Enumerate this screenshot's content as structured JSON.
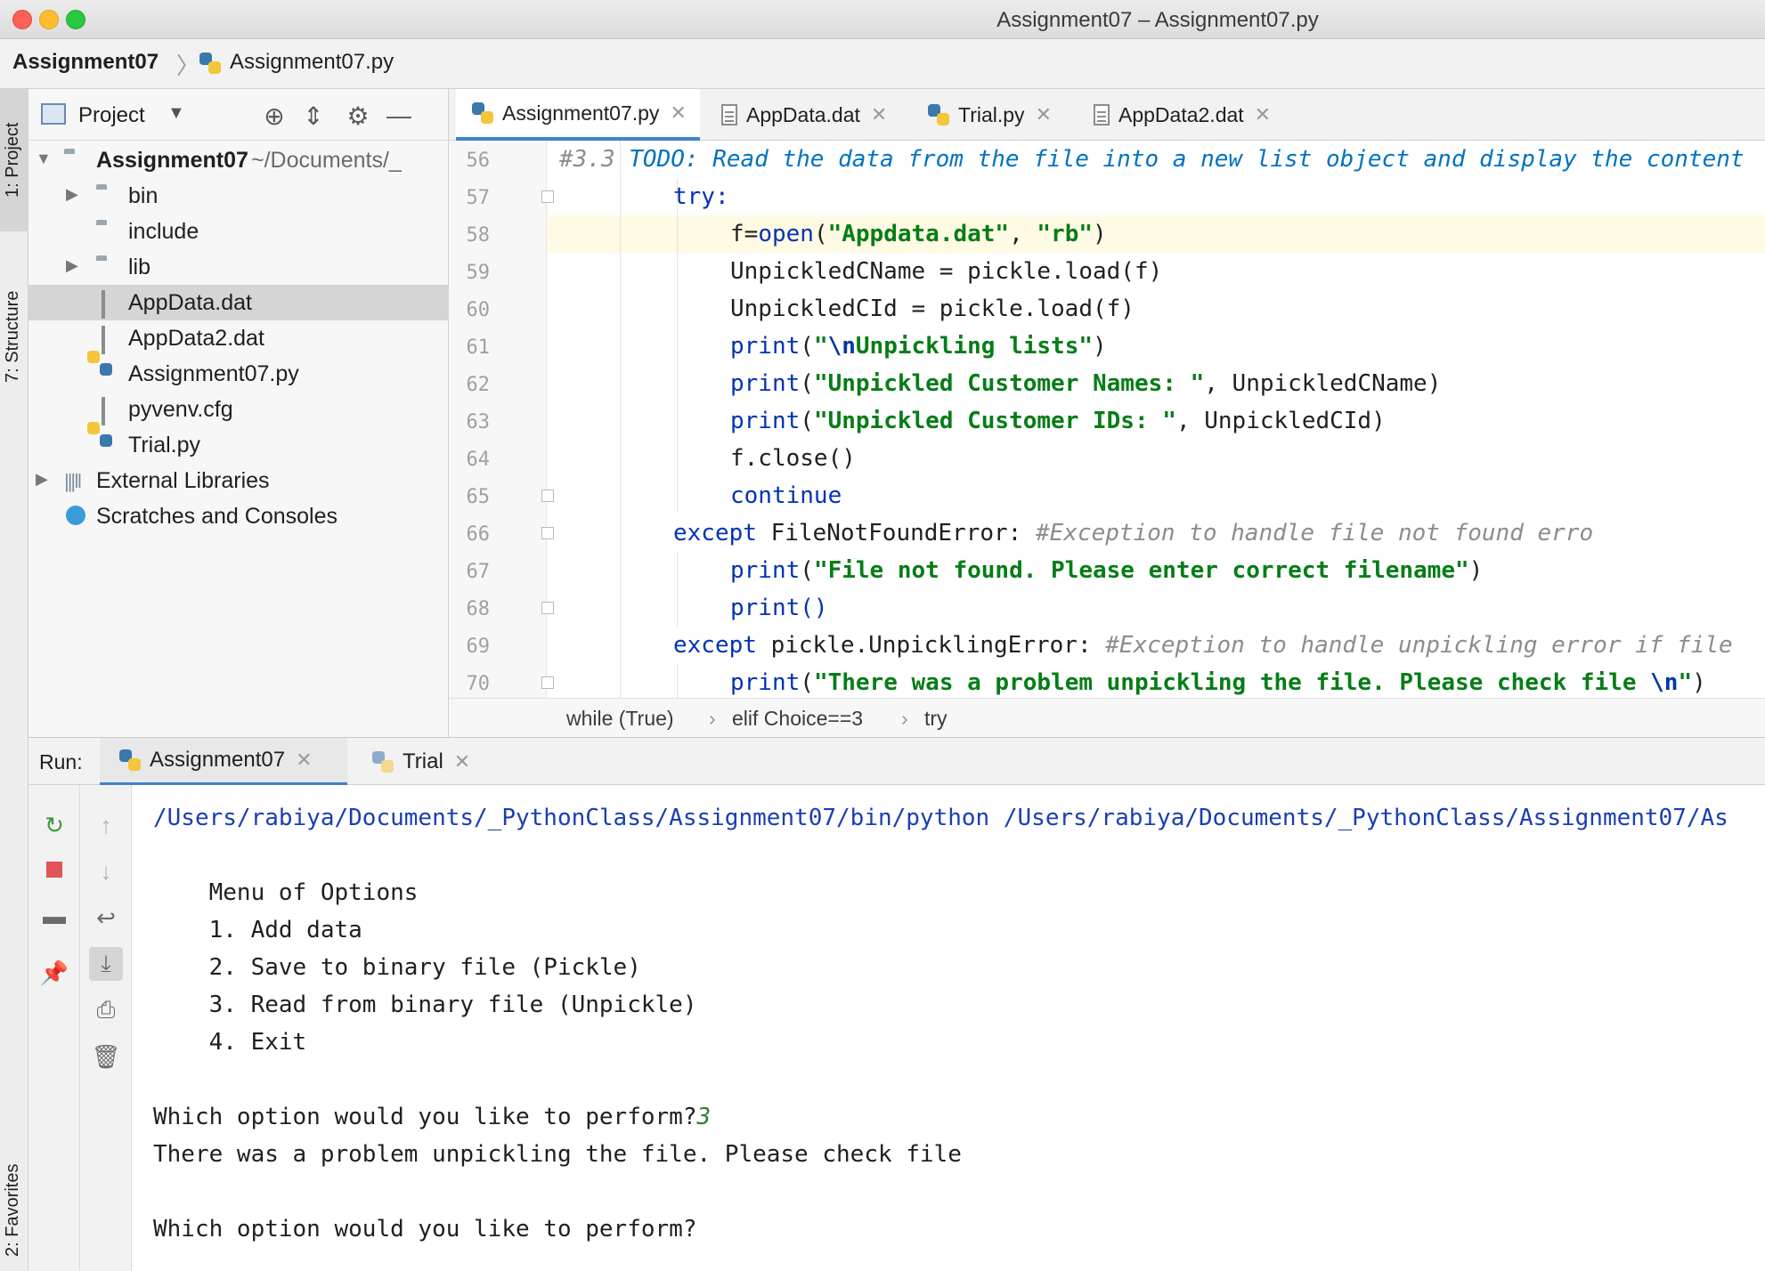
{
  "window": {
    "title": "Assignment07 – Assignment07.py"
  },
  "navbar": {
    "project": "Assignment07",
    "separator": "〉",
    "file": "Assignment07.py"
  },
  "side_tabs": {
    "project": "1: Project",
    "structure": "7: Structure",
    "favorites": "2: Favorites"
  },
  "project_panel": {
    "title": "Project",
    "tree": [
      {
        "label": "Assignment07",
        "suffix": "~/Documents/_",
        "type": "folder",
        "bold": true
      },
      {
        "label": "bin",
        "type": "folder"
      },
      {
        "label": "include",
        "type": "folder"
      },
      {
        "label": "lib",
        "type": "folder"
      },
      {
        "label": "AppData.dat",
        "type": "file",
        "selected": true
      },
      {
        "label": "AppData2.dat",
        "type": "file"
      },
      {
        "label": "Assignment07.py",
        "type": "py"
      },
      {
        "label": "pyvenv.cfg",
        "type": "file"
      },
      {
        "label": "Trial.py",
        "type": "py"
      },
      {
        "label": "External Libraries",
        "type": "lib"
      },
      {
        "label": "Scratches and Consoles",
        "type": "scratch"
      }
    ]
  },
  "editor_tabs": [
    {
      "label": "Assignment07.py",
      "icon": "python-file-icon",
      "active": true
    },
    {
      "label": "AppData.dat",
      "icon": "text-file-icon"
    },
    {
      "label": "Trial.py",
      "icon": "python-file-icon"
    },
    {
      "label": "AppData2.dat",
      "icon": "text-file-icon"
    }
  ],
  "editor": {
    "current_line": "58",
    "lines": [
      {
        "n": "56"
      },
      {
        "n": "57"
      },
      {
        "n": "58"
      },
      {
        "n": "59"
      },
      {
        "n": "60"
      },
      {
        "n": "61"
      },
      {
        "n": "62"
      },
      {
        "n": "63"
      },
      {
        "n": "64"
      },
      {
        "n": "65"
      },
      {
        "n": "66"
      },
      {
        "n": "67"
      },
      {
        "n": "68"
      },
      {
        "n": "69"
      },
      {
        "n": "70"
      }
    ],
    "code": {
      "l56_cmt": "#3.3 ",
      "l56_todo": "TODO: Read the data from the file into a new list object and display the content",
      "l57": "try:",
      "l58_a": "f=",
      "l58_b": "open",
      "l58_c": "(",
      "l58_d": "\"Appdata.dat\"",
      "l58_e": ", ",
      "l58_f": "\"rb\"",
      "l58_g": ")",
      "l59": "UnpickledCName = pickle.load(f)",
      "l60": "UnpickledCId = pickle.load(f)",
      "l61_a": "print",
      "l61_b": "(",
      "l61_c": "\"",
      "l61_d": "\\n",
      "l61_e": "Unpickling lists\"",
      "l61_f": ")",
      "l62_a": "print",
      "l62_b": "(",
      "l62_c": "\"Unpickled Customer Names: \"",
      "l62_d": ", UnpickledCName)",
      "l63_a": "print",
      "l63_b": "(",
      "l63_c": "\"Unpickled Customer IDs: \"",
      "l63_d": ", UnpickledCId)",
      "l64": "f.close()",
      "l65": "continue",
      "l66_a": "except ",
      "l66_b": "FileNotFoundError: ",
      "l66_c": "#Exception to handle file not found erro",
      "l67_a": "print",
      "l67_b": "(",
      "l67_c": "\"File not found. Please enter correct filename\"",
      "l67_d": ")",
      "l68": "print()",
      "l69_a": "except ",
      "l69_b": "pickle.UnpicklingError: ",
      "l69_c": "#Exception to handle unpickling error if file",
      "l70_a": "print",
      "l70_b": "(",
      "l70_c": "\"There was a problem unpickling the file. Please check file ",
      "l70_d": "\\n",
      "l70_e": "\"",
      "l70_f": ")"
    }
  },
  "breadcrumb": {
    "items": [
      "while (True)",
      "elif Choice==3",
      "try"
    ],
    "sep": "›"
  },
  "run": {
    "label": "Run:",
    "tabs": [
      {
        "label": "Assignment07",
        "active": true
      },
      {
        "label": "Trial"
      }
    ],
    "console": {
      "path": "/Users/rabiya/Documents/_PythonClass/Assignment07/bin/python /Users/rabiya/Documents/_PythonClass/Assignment07/As",
      "menu_title": "    Menu of Options",
      "opt1": "    1. Add data",
      "opt2": "    2. Save to binary file (Pickle)",
      "opt3": "    3. Read from binary file (Unpickle)",
      "opt4": "    4. Exit",
      "prompt1": "Which option would you like to perform?",
      "input1": "3",
      "error": "There was a problem unpickling the file. Please check file",
      "prompt2": "Which option would you like to perform?"
    }
  },
  "colors": {
    "keyword": "#0033b3",
    "string": "#067d17",
    "comment": "#8c8c8c",
    "accent": "#4083c9",
    "current_line": "#fffae3"
  }
}
